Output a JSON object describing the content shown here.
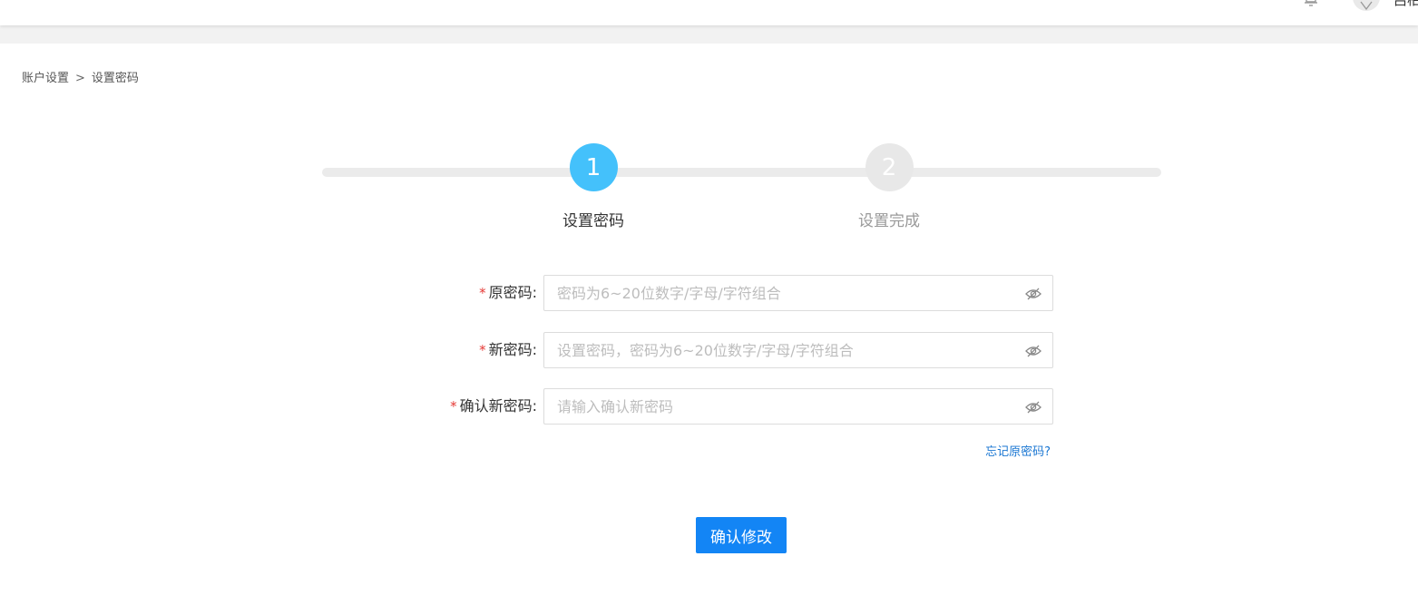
{
  "header": {
    "username": "吕柏"
  },
  "breadcrumb": {
    "parent": "账户设置",
    "separator": ">",
    "current": "设置密码"
  },
  "steps": [
    {
      "number": "1",
      "label": "设置密码",
      "status": "active"
    },
    {
      "number": "2",
      "label": "设置完成",
      "status": "inactive"
    }
  ],
  "form": {
    "required_mark": "*",
    "old_password": {
      "label": "原密码:",
      "placeholder": "密码为6~20位数字/字母/字符组合"
    },
    "new_password": {
      "label": "新密码:",
      "placeholder": "设置密码，密码为6~20位数字/字母/字符组合"
    },
    "confirm_password": {
      "label": "确认新密码:",
      "placeholder": "请输入确认新密码"
    },
    "forgot_link": "忘记原密码?",
    "submit_label": "确认修改"
  },
  "colors": {
    "active_step": "#44c1fb",
    "inactive_step": "#e8e8e8",
    "primary_button": "#1385f5",
    "link": "#1976d2",
    "required": "#e53935"
  },
  "icons": {
    "header_bell": "bell-icon",
    "header_avatar": "user-avatar-icon",
    "password_toggle": "eye-off-icon"
  }
}
